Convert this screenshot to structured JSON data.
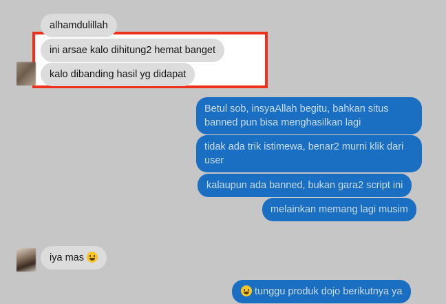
{
  "messages": {
    "m1": "alhamdulillah",
    "m2": "ini arsae kalo dihitung2 hemat banget",
    "m3": "kalo dibanding hasil yg didapat",
    "m4": "Betul sob, insyaAllah begitu, bahkan situs banned pun bisa menghasilkan lagi",
    "m5": "tidak ada trik istimewa, benar2 murni klik dari user",
    "m6": "kalaupun ada banned, bukan gara2 script ini",
    "m7": "melainkan memang lagi musim",
    "m8": "iya mas",
    "m9": "tunggu produk dojo berikutnya ya"
  },
  "icons": {
    "emoji": "grinning-face-emoji",
    "emoji_sweat": "smiling-face-with-sweat-emoji"
  },
  "colors": {
    "background": "#c6c6c6",
    "incoming_bubble": "#dcdcdc",
    "outgoing_bubble": "#1a6fc2",
    "highlight_border": "#f0301a"
  }
}
